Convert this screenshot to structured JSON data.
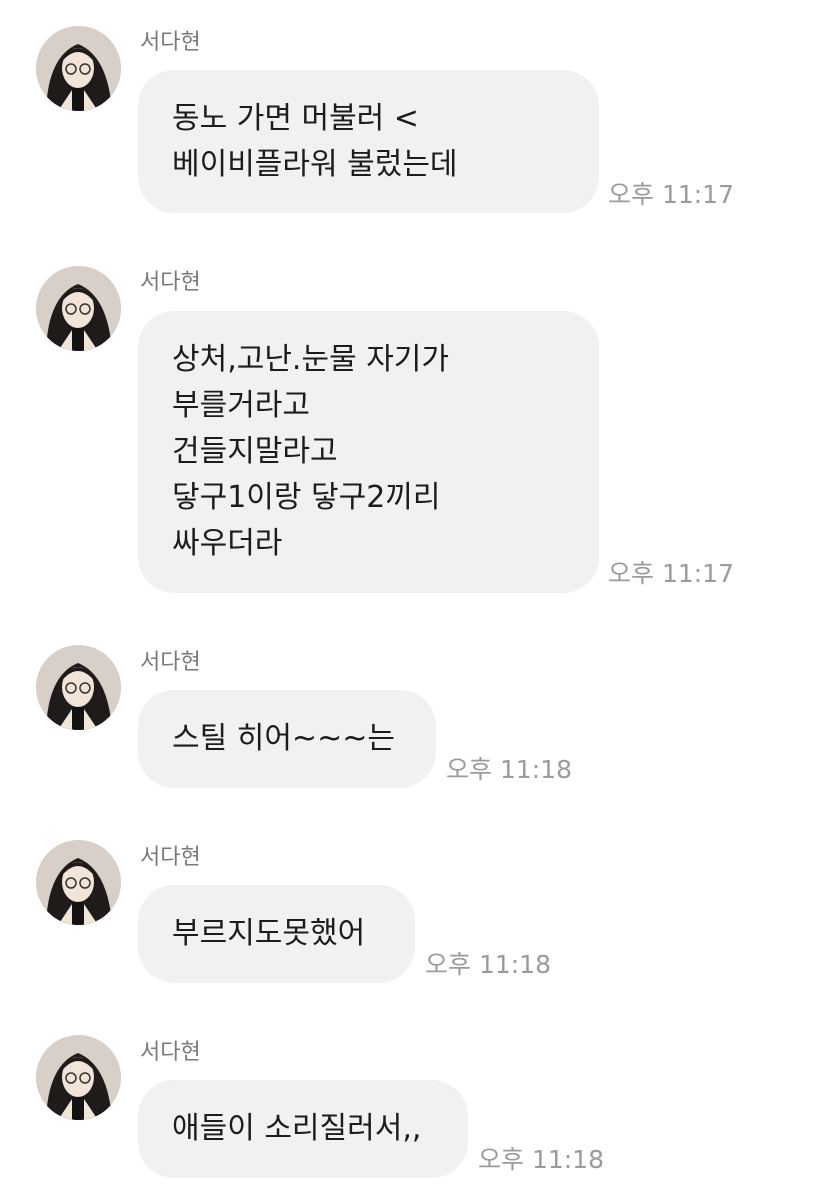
{
  "chat": {
    "messages": [
      {
        "sender": "서다현",
        "lines": [
          "동노 가면 머불러 <",
          "베이비플라워 불렀는데"
        ],
        "time": "오후 11:17"
      },
      {
        "sender": "서다현",
        "lines": [
          "상처,고난.눈물 자기가",
          "부를거라고",
          "건들지말라고",
          "닿구1이랑 닿구2끼리",
          "싸우더라"
        ],
        "time": "오후 11:17"
      },
      {
        "sender": "서다현",
        "lines": [
          "스틸 히어~~~는"
        ],
        "time": "오후 11:18"
      },
      {
        "sender": "서다현",
        "lines": [
          "부르지도못했어"
        ],
        "time": "오후 11:18"
      },
      {
        "sender": "서다현",
        "lines": [
          "애들이 소리질러서,,"
        ],
        "time": "오후 11:18"
      }
    ]
  }
}
